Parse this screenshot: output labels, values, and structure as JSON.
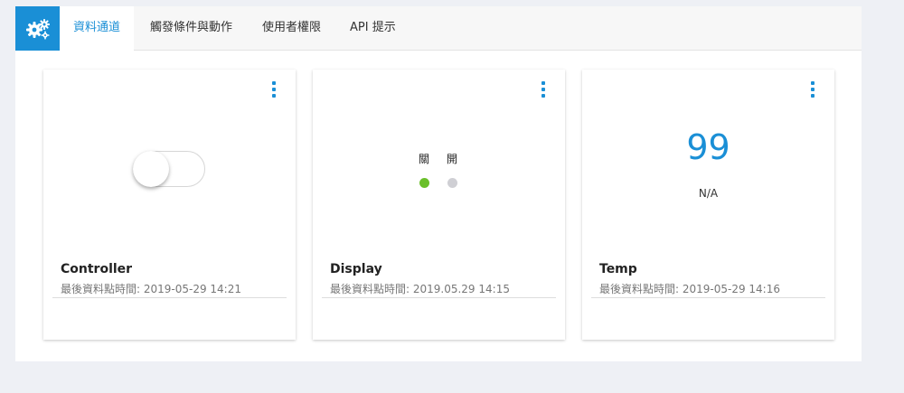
{
  "tabs": [
    {
      "label": "資料通道",
      "active": true
    },
    {
      "label": "觸發條件與動作",
      "active": false
    },
    {
      "label": "使用者權限",
      "active": false
    },
    {
      "label": "API 提示",
      "active": false
    }
  ],
  "colors": {
    "accent": "#1a8fd6",
    "on_dot": "#6abf2a",
    "off_dot": "#cfcfd4"
  },
  "cards": [
    {
      "title": "Controller",
      "time_label": "最後資料點時間: ",
      "time_value": "2019-05-29 14:21",
      "widget": "toggle",
      "toggle_on": false
    },
    {
      "title": "Display",
      "time_label": "最後資料點時間: ",
      "time_value": "2019.05.29 14:15",
      "widget": "indicator",
      "off_label": "關",
      "on_label": "開"
    },
    {
      "title": "Temp",
      "time_label": "最後資料點時間: ",
      "time_value": "2019-05-29 14:16",
      "widget": "value",
      "value": "99",
      "unit": "N/A"
    }
  ]
}
